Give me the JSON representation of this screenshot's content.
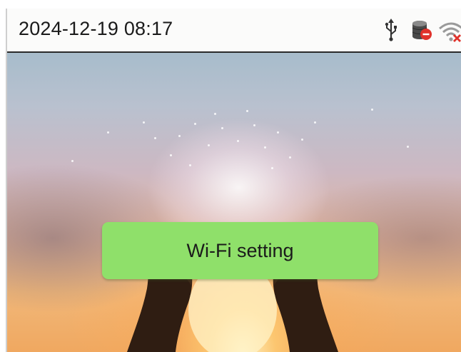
{
  "status_bar": {
    "datetime": "2024-12-19 08:17",
    "icons": [
      "usb-icon",
      "server-disconnected-icon",
      "wifi-disconnected-icon"
    ]
  },
  "toast": {
    "label": "Wi-Fi setting"
  },
  "colors": {
    "toast_background": "#8fe06a",
    "status_bar_background": "#fbfbfa",
    "alert_red": "#e0322b"
  }
}
